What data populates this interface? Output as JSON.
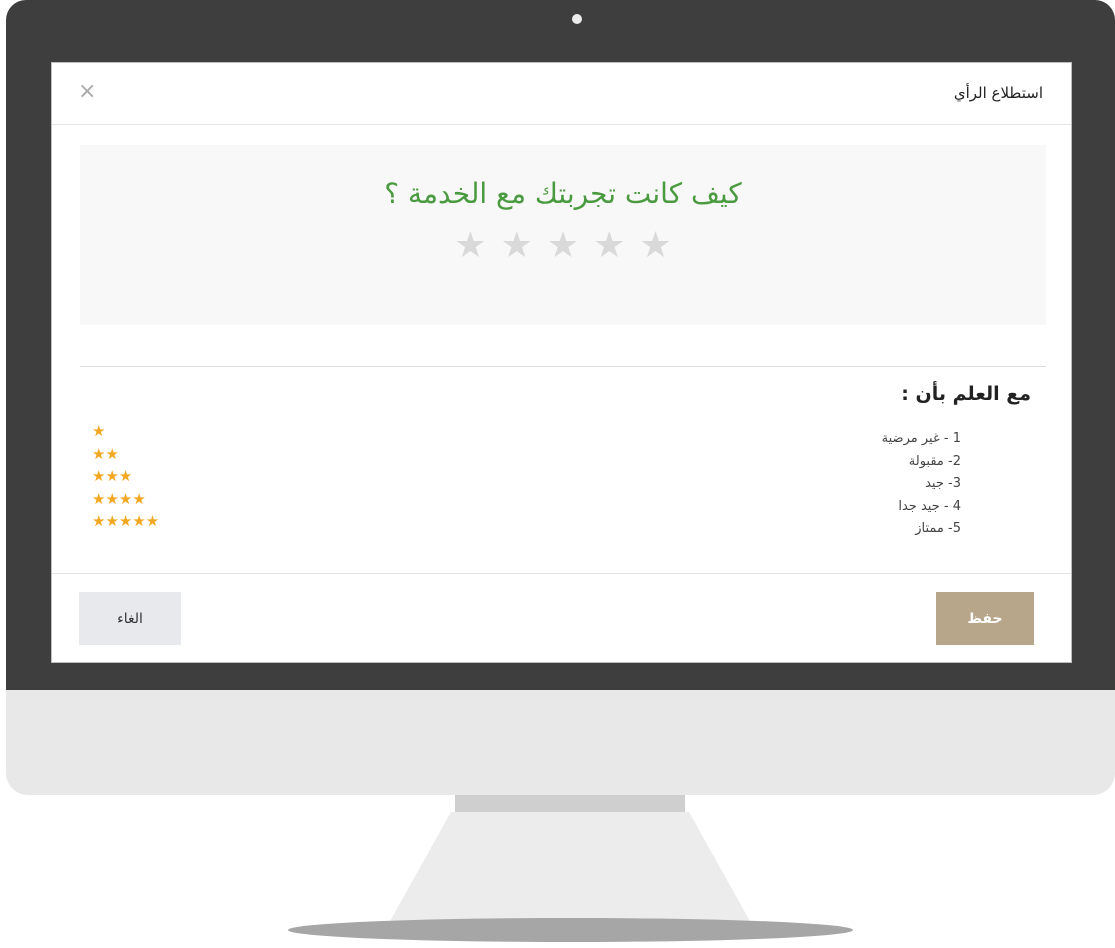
{
  "modal": {
    "title": "استطلاع الرأي",
    "close_icon": "×"
  },
  "rating": {
    "question": "كيف كانت تجربتك مع الخدمة ؟",
    "star_glyph": "★",
    "star_count": 5,
    "selected": 0
  },
  "legend": {
    "title": "مع العلم بأن :",
    "items": [
      "1 - غير مرضية",
      "2- مقبولة",
      "3- جيد",
      "4 - جيد جدا",
      "5- ممتاز"
    ],
    "star_rows": [
      "★",
      "★★",
      "★★★",
      "★★★★",
      "★★★★★"
    ]
  },
  "footer": {
    "save_label": "حفظ",
    "cancel_label": "الغاء"
  },
  "colors": {
    "question": "#4a9a3f",
    "empty_star": "#d9d9d9",
    "legend_star": "#f3a823",
    "save_button": "#b7a68a",
    "cancel_button": "#e7e9ec"
  }
}
